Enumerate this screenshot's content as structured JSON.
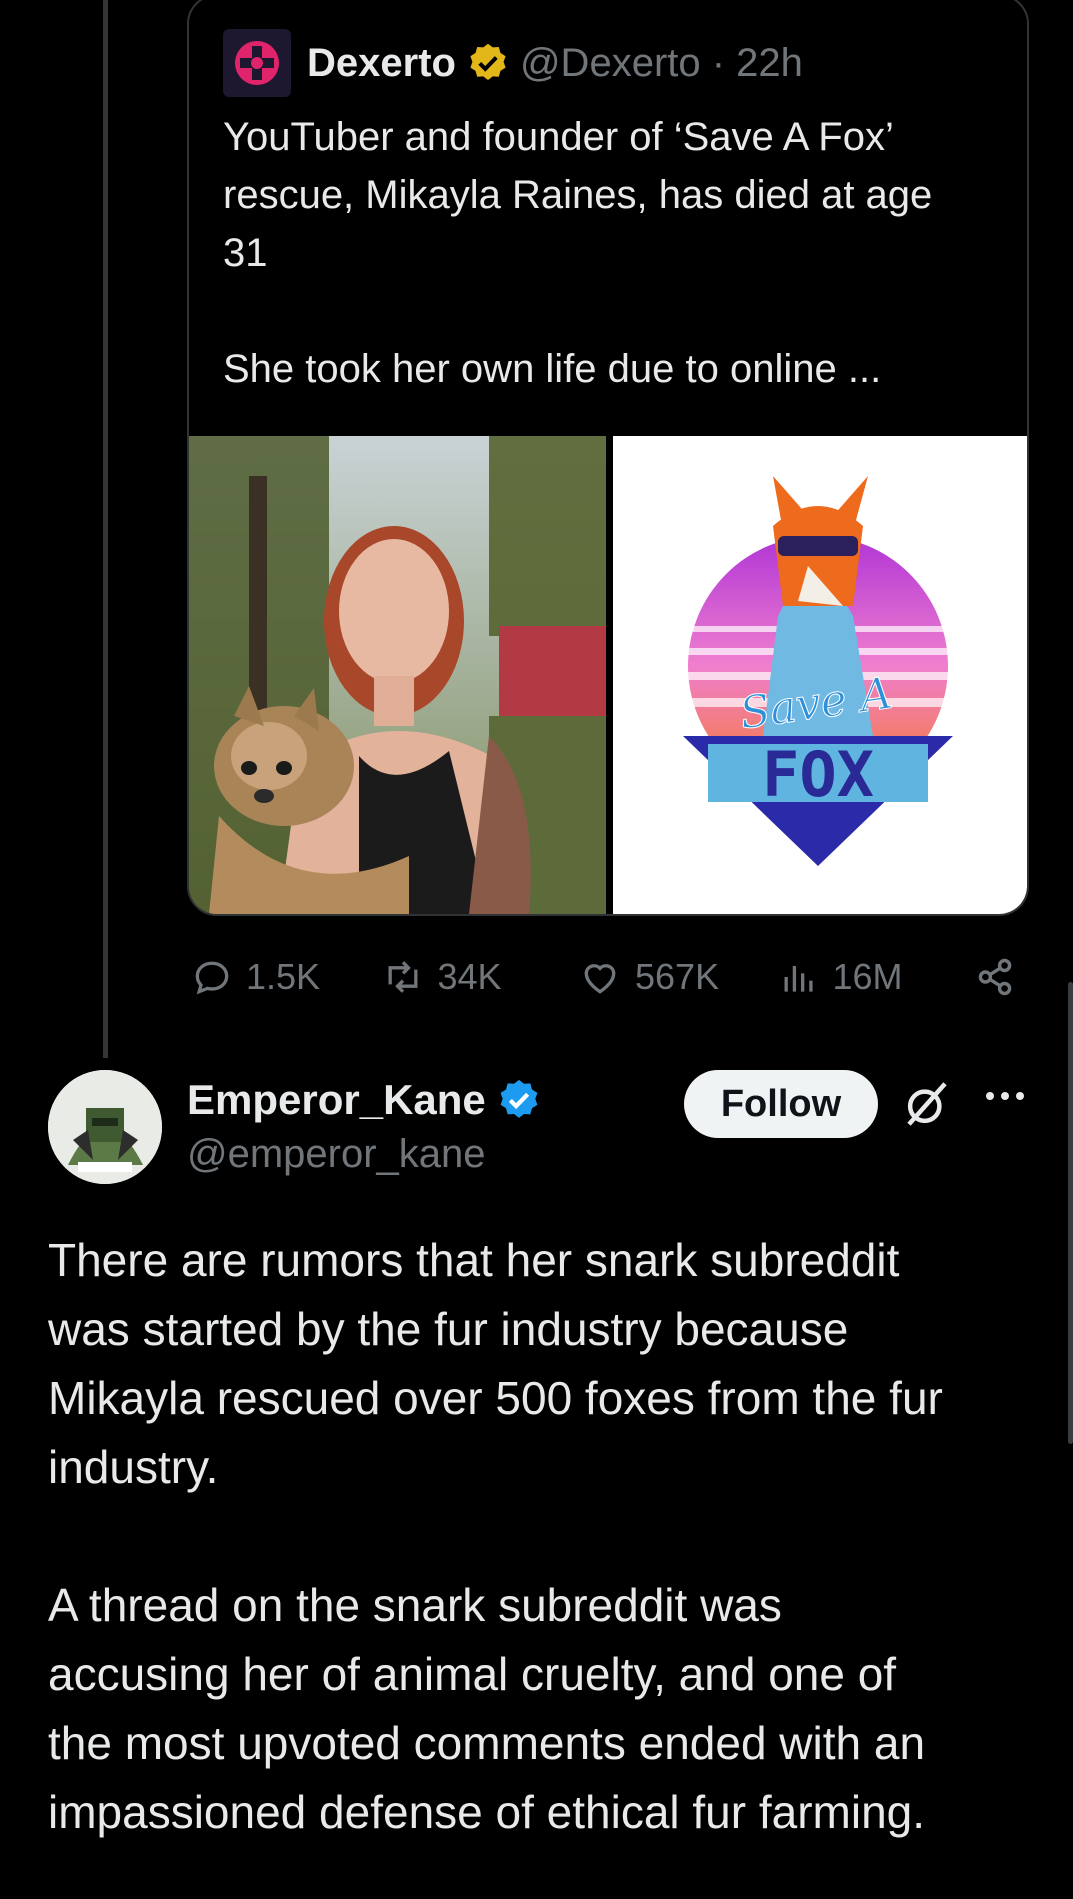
{
  "quoted_post": {
    "author_name": "Dexerto",
    "handle_time": "@Dexerto · 22h",
    "text": "YouTuber and founder of ‘Save A Fox’\nrescue, Mikayla Raines, has died at age\n31\n\nShe took her own life due to online ...",
    "logo_text_top": "Save A",
    "logo_text_bottom": "FOX"
  },
  "engagement": {
    "replies": "1.5K",
    "reposts": "34K",
    "likes": "567K",
    "views": "16M"
  },
  "reply_post": {
    "author_name": "Emperor_Kane",
    "handle": "@emperor_kane",
    "follow_label": "Follow",
    "text": "There are rumors that her snark subreddit\nwas started by the fur industry because\nMikayla rescued over 500 foxes from the fur\nindustry.\n\nA thread on the snark subreddit was\naccusing her of animal cruelty, and one of\nthe most upvoted comments ended with an\nimpassioned defense of ethical fur farming."
  },
  "colors": {
    "background": "#000000",
    "text": "#e7e9ea",
    "muted": "#71767b",
    "verified_blue": "#1d9bf0",
    "verified_gold": "#e2b719"
  }
}
